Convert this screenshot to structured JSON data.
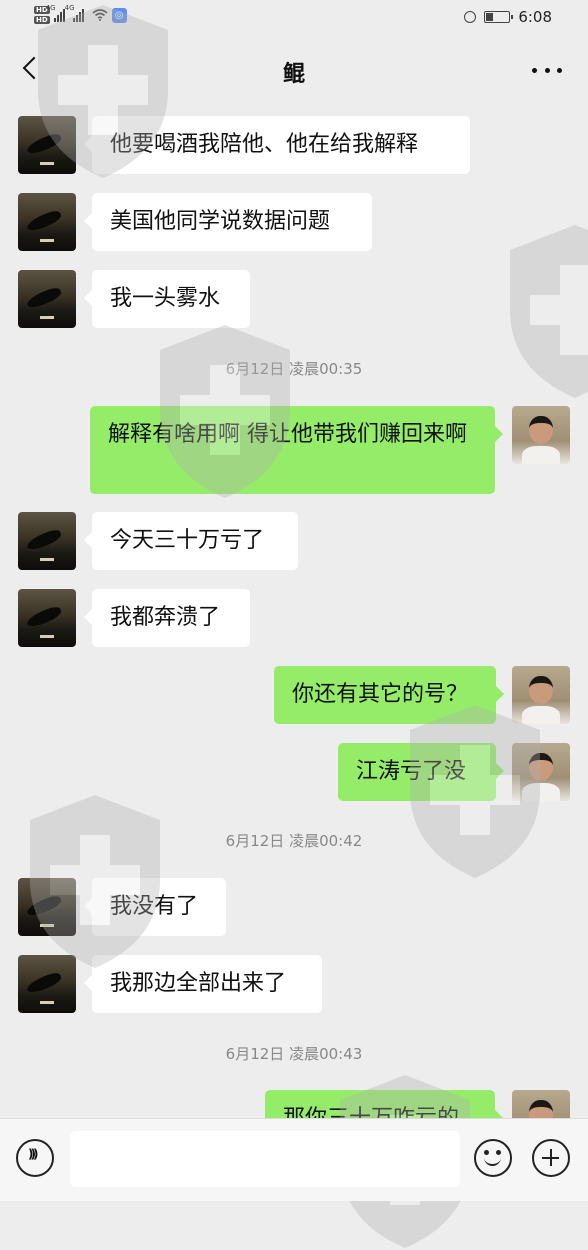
{
  "status_bar": {
    "sim1": "HD",
    "sim2": "HD",
    "network1": "4G",
    "network2": "4G",
    "app_badge": "◎",
    "time": "6:08",
    "battery_fraction": 0.35
  },
  "header": {
    "title": "鲲"
  },
  "messages": [
    {
      "side": "in",
      "text": "他要喝酒我陪他、他在给我解释"
    },
    {
      "side": "in",
      "text": "美国他同学说数据问题"
    },
    {
      "side": "in",
      "text": "我一头雾水"
    },
    {
      "type": "time",
      "text": "6月12日 凌晨00:35"
    },
    {
      "side": "out",
      "text": "解释有啥用啊   得让他带我们赚回来啊"
    },
    {
      "side": "in",
      "text": "今天三十万亏了"
    },
    {
      "side": "in",
      "text": "我都奔溃了"
    },
    {
      "side": "out",
      "text": "你还有其它的号？"
    },
    {
      "side": "out",
      "text": "江涛亏了没"
    },
    {
      "type": "time",
      "text": "6月12日 凌晨00:42"
    },
    {
      "side": "in",
      "text": "我没有了"
    },
    {
      "side": "in",
      "text": "我那边全部出来了"
    },
    {
      "type": "time",
      "text": "6月12日 凌晨00:43"
    },
    {
      "side": "out",
      "text": "那你三十万咋亏的"
    }
  ],
  "input_bar": {
    "placeholder": ""
  },
  "icons": {
    "back": "back-arrow-icon",
    "more": "more-icon",
    "voice": "voice-icon",
    "emoji": "emoji-icon",
    "plus": "plus-icon"
  }
}
